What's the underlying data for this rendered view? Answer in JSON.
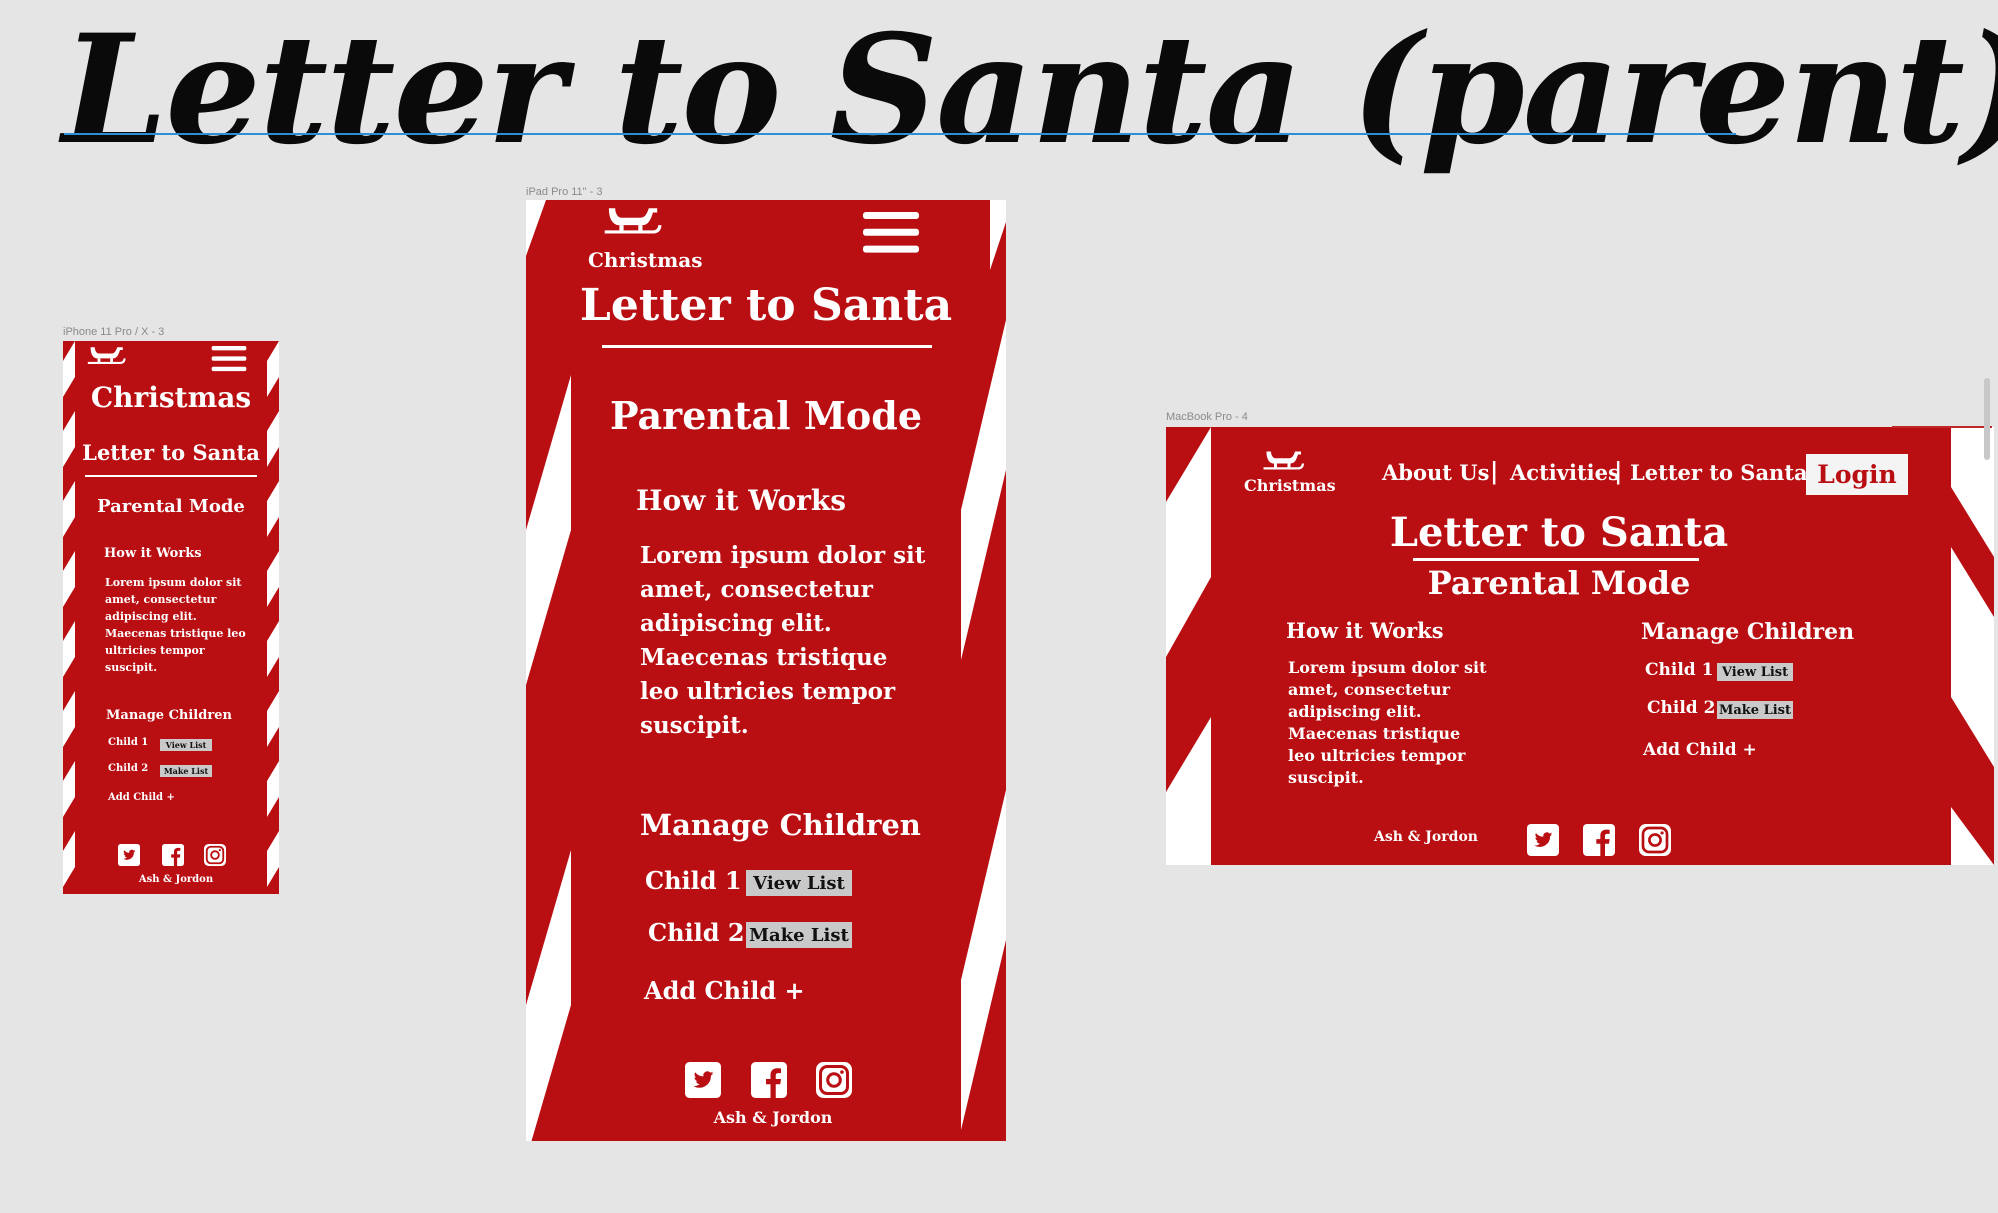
{
  "page": {
    "title": "Letter to Santa (parent)",
    "accent_color": "#b90e12",
    "guide_color": "#2d8fd8"
  },
  "frames": {
    "phone": {
      "label": "iPhone 11 Pro / X - 3",
      "brand": "Christmas",
      "title": "Letter to Santa",
      "mode": "Parental Mode",
      "how_heading": "How it Works",
      "body": "Lorem ipsum dolor sit amet, consectetur adipiscing elit. Maecenas tristique leo ultricies tempor suscipit.",
      "manage_heading": "Manage Children",
      "children": [
        {
          "name": "Child 1",
          "action": "View List"
        },
        {
          "name": "Child 2",
          "action": "Make List"
        }
      ],
      "add_child": "Add Child +",
      "footer": "Ash & Jordon"
    },
    "tablet": {
      "label": "iPad Pro 11\" - 3",
      "brand": "Christmas",
      "title": "Letter to Santa",
      "mode": "Parental Mode",
      "how_heading": "How it Works",
      "body_lines": [
        "Lorem ipsum dolor sit",
        "amet, consectetur",
        "adipiscing elit.",
        "Maecenas tristique",
        "leo ultricies tempor",
        "suscipit."
      ],
      "manage_heading": "Manage Children",
      "children": [
        {
          "name": "Child 1",
          "action": "View List"
        },
        {
          "name": "Child 2",
          "action": "Make List"
        }
      ],
      "add_child": "Add Child +",
      "footer": "Ash & Jordon"
    },
    "desktop": {
      "label": "MacBook Pro - 4",
      "brand": "Christmas",
      "nav": [
        "About Us",
        "Activities",
        "Letter to Santa"
      ],
      "nav_separator": "|",
      "login": "Login",
      "title": "Letter to Santa",
      "mode": "Parental Mode",
      "how_heading": "How it Works",
      "body_lines": [
        "Lorem ipsum dolor sit",
        "amet, consectetur",
        "adipiscing elit.",
        "Maecenas tristique",
        "leo ultricies tempor",
        "suscipit."
      ],
      "manage_heading": "Manage Children",
      "children": [
        {
          "name": "Child 1",
          "action": "View List"
        },
        {
          "name": "Child 2",
          "action": "Make List"
        }
      ],
      "add_child": "Add Child +",
      "footer": "Ash & Jordon"
    }
  },
  "icons": [
    "sleigh-icon",
    "hamburger-menu-icon",
    "twitter-icon",
    "facebook-icon",
    "instagram-icon"
  ]
}
